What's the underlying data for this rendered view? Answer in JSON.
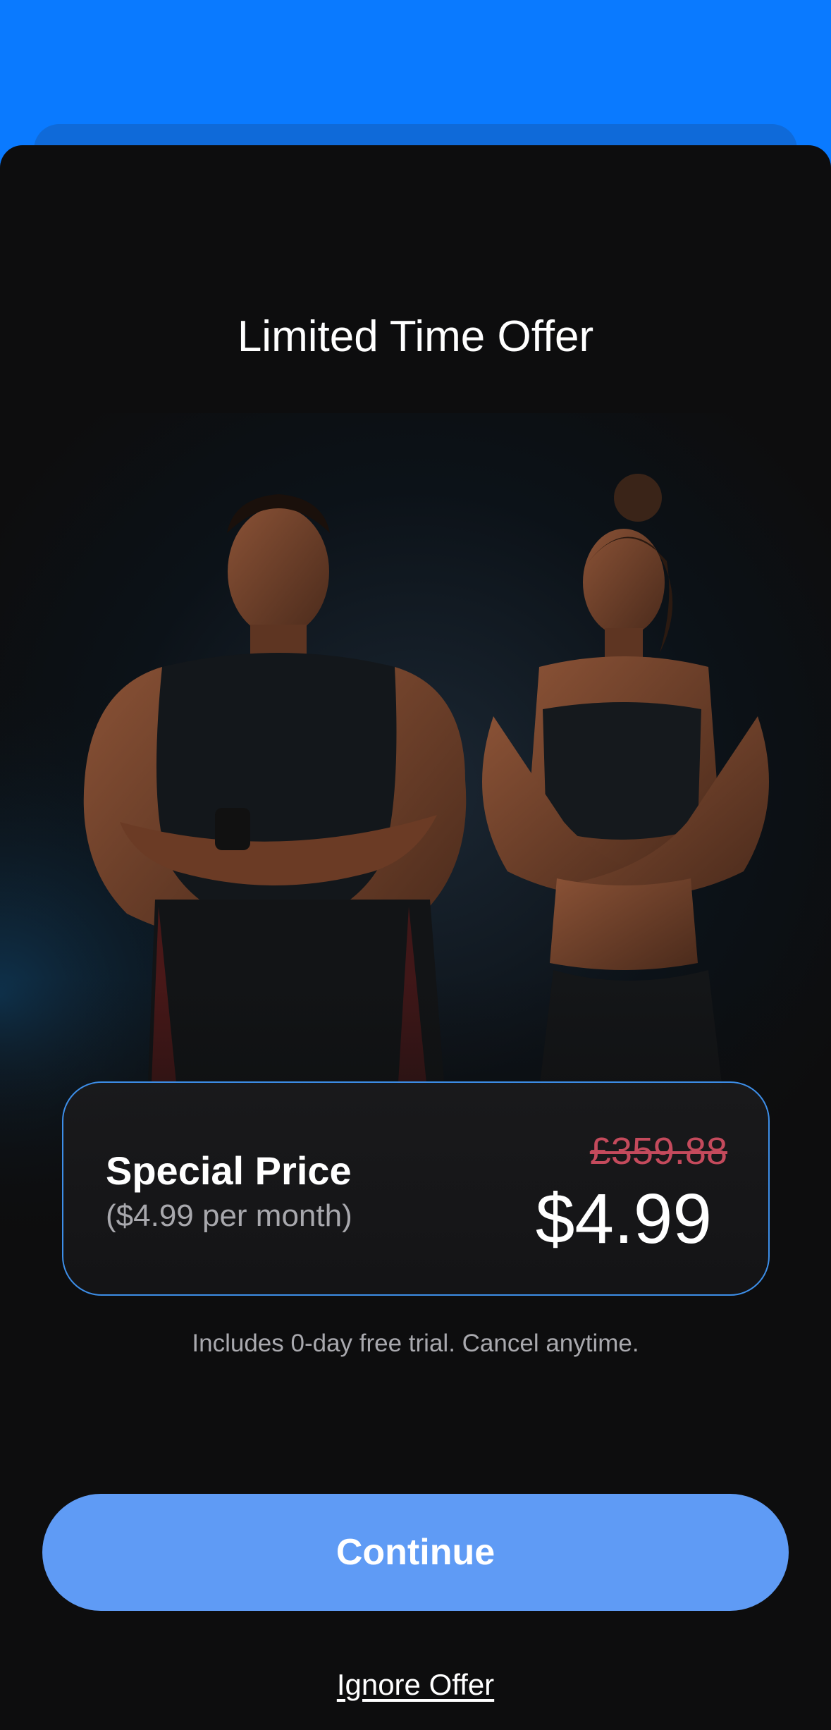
{
  "header": {
    "title": "Limited Time Offer"
  },
  "hero": {
    "image": "athletes-man-and-woman-arms-crossed"
  },
  "offer": {
    "label": "Special Price",
    "per_month": "($4.99 per month)",
    "original_price": "£359.88",
    "price": "$4.99"
  },
  "trial_note": "Includes 0-day free trial. Cancel anytime.",
  "actions": {
    "continue_label": "Continue",
    "ignore_label": "Ignore Offer"
  },
  "colors": {
    "top_background": "#0a7aff",
    "sheet_background": "#0d0d0e",
    "card_border": "#3d8ee8",
    "strike_price": "#c44a5c",
    "button": "#5f9bf5"
  }
}
